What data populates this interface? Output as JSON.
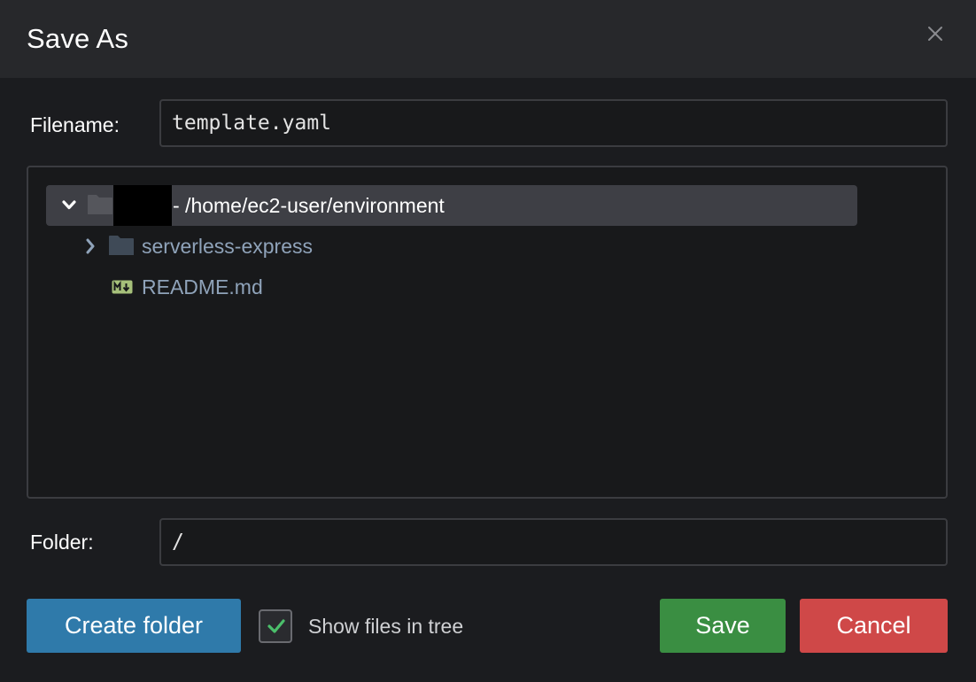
{
  "dialog": {
    "title": "Save As",
    "close_icon": "close-icon"
  },
  "filename": {
    "label": "Filename:",
    "value": "template.yaml"
  },
  "tree": {
    "root": {
      "expanded": true,
      "icon": "folder-icon",
      "name_redacted": true,
      "path": "- /home/ec2-user/environment"
    },
    "items": [
      {
        "type": "folder",
        "expanded": false,
        "icon": "folder-icon",
        "label": "serverless-express"
      },
      {
        "type": "file",
        "icon": "markdown-file-icon",
        "label": "README.md"
      }
    ]
  },
  "folder": {
    "label": "Folder:",
    "value": "/"
  },
  "actions": {
    "create_folder": "Create folder",
    "show_files_label": "Show files in tree",
    "show_files_checked": true,
    "save": "Save",
    "cancel": "Cancel"
  },
  "colors": {
    "create_folder": "#2f7aaa",
    "save": "#3a8e42",
    "cancel": "#cf4848",
    "tree_text": "#8fa3ba",
    "checkmark": "#4bbf6b",
    "markdown_icon": "#a6c07a"
  }
}
